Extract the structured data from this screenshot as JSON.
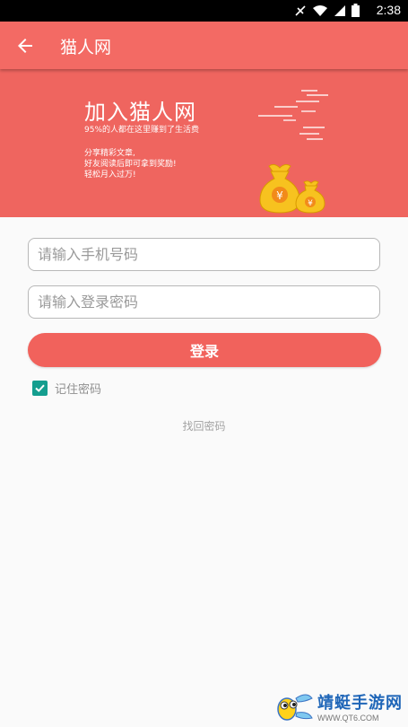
{
  "status_bar": {
    "time": "2:38"
  },
  "app_bar": {
    "title": "猫人网"
  },
  "banner": {
    "headline": "加入猫人网",
    "subtitle": "95%的人都在这里赚到了生活费",
    "lines": [
      "分享精彩文章,",
      "好友阅读后即可拿到奖励!",
      "轻松月入过万!"
    ]
  },
  "form": {
    "phone_placeholder": "请输入手机号码",
    "phone_value": "",
    "password_placeholder": "请输入登录密码",
    "password_value": "",
    "login_label": "登录",
    "remember_label": "记住密码",
    "remember_checked": true,
    "forgot_label": "找回密码"
  },
  "watermark": {
    "name": "靖蜓手游网",
    "url": "WWW.QT6.COM"
  },
  "colors": {
    "primary": "#f36a64",
    "accent": "#149e8f",
    "banner": "#ef655f"
  }
}
